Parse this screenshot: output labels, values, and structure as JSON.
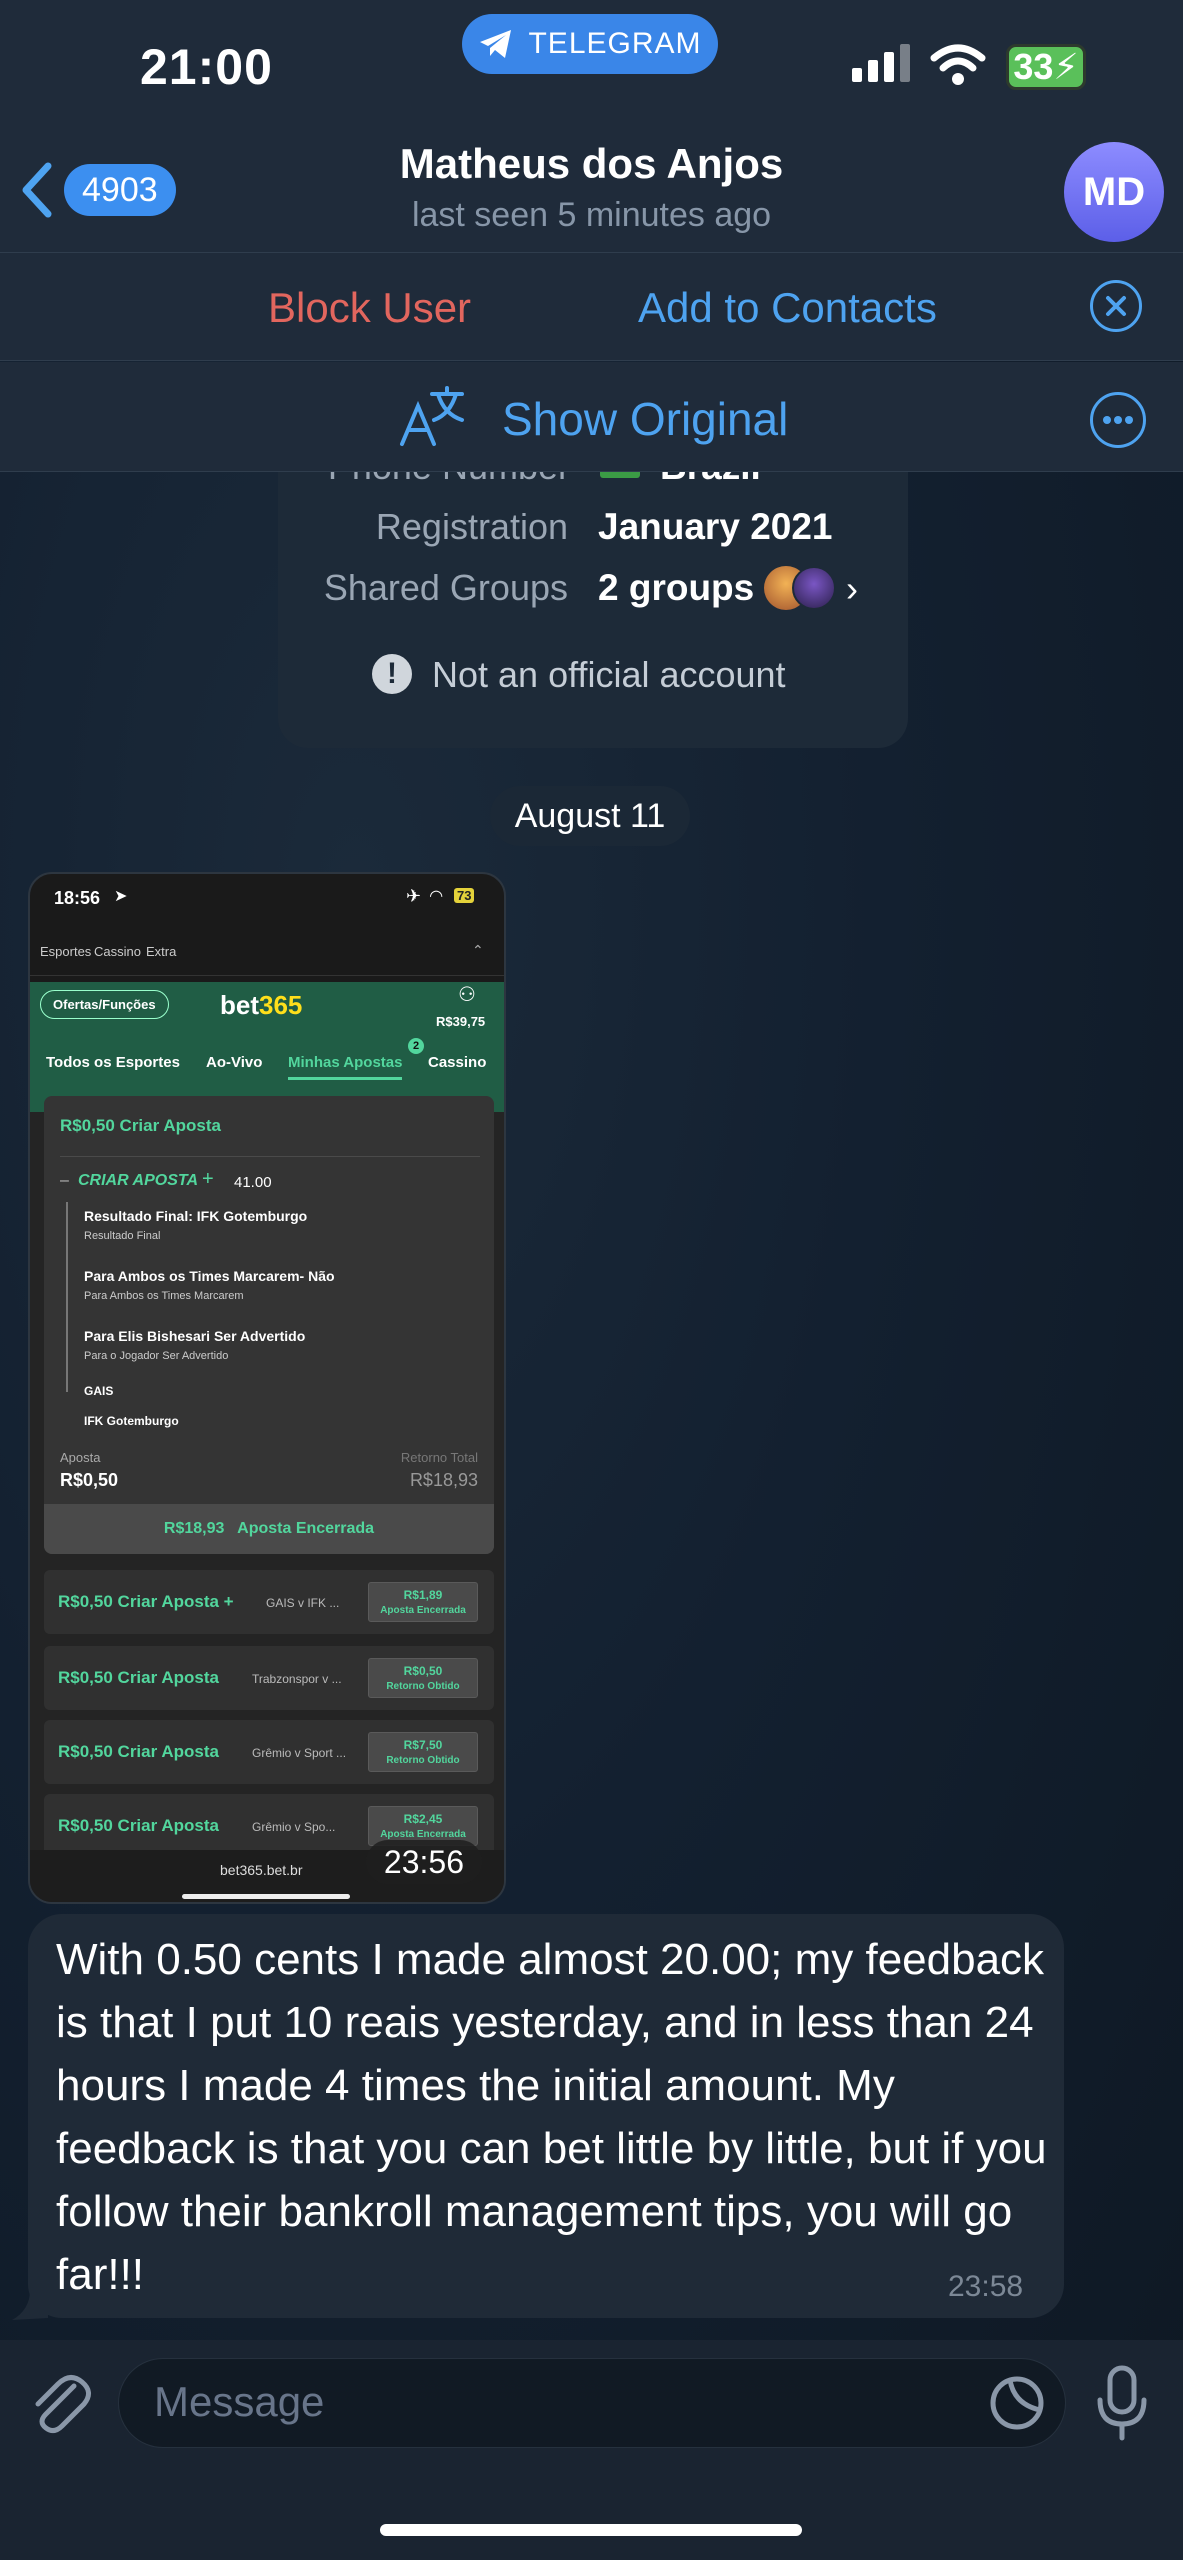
{
  "status_bar": {
    "time": "21:00",
    "battery": "33"
  },
  "telegram_pill": {
    "label": "TELEGRAM"
  },
  "header": {
    "back_count": "4903",
    "title": "Matheus dos Anjos",
    "subtitle": "last seen 5 minutes ago",
    "avatar_initials": "MD"
  },
  "actions": {
    "block": "Block User",
    "add_contacts": "Add to Contacts"
  },
  "translate": {
    "label": "Show Original"
  },
  "info_card": {
    "phone_label": "Phone Number",
    "phone_value": "Brazil",
    "registration_label": "Registration",
    "registration_value": "January 2021",
    "groups_label": "Shared Groups",
    "groups_value": "2 groups",
    "notice": "Not an official account"
  },
  "date_separator": "August 11",
  "screenshot": {
    "time": "18:56",
    "battery": "73",
    "nav": [
      "Esportes",
      "Cassino",
      "Extra"
    ],
    "offers": "Ofertas/Funções",
    "logo_a": "bet",
    "logo_b": "365",
    "balance": "R$39,75",
    "tabs": [
      "Todos os Esportes",
      "Ao-Vivo",
      "Minhas Apostas",
      "Cassino"
    ],
    "tab_badge": "2",
    "card_title": "R$0,50 Criar Aposta",
    "criar_label": "CRIAR APOSTA",
    "odds": "41.00",
    "selections": [
      {
        "title": "Resultado Final: IFK Gotemburgo",
        "sub": "Resultado Final"
      },
      {
        "title": "Para Ambos os Times Marcarem- Não",
        "sub": "Para Ambos os Times Marcarem"
      },
      {
        "title": "Para Elis Bishesari Ser Advertido",
        "sub": "Para o Jogador Ser Advertido"
      }
    ],
    "team1": "GAIS",
    "team2": "IFK Gotemburgo",
    "stake_label": "Aposta",
    "stake_value": "R$0,50",
    "return_label": "Retorno Total",
    "return_value": "R$18,93",
    "closed_bar": "R$18,93   Aposta Encerrada",
    "rows": [
      {
        "label": "R$0,50 Criar Aposta +",
        "meta": "GAIS v IFK ...",
        "amount": "R$1,89",
        "status": "Aposta Encerrada"
      },
      {
        "label": "R$0,50 Criar Aposta",
        "meta": "Trabzonspor v ...",
        "amount": "R$0,50",
        "status": "Retorno Obtido"
      },
      {
        "label": "R$0,50 Criar Aposta",
        "meta": "Grêmio v Sport ...",
        "amount": "R$7,50",
        "status": "Retorno Obtido"
      },
      {
        "label": "R$0,50 Criar Aposta",
        "meta": "Grêmio v Spo...",
        "amount": "R$2,45",
        "status": "Aposta Encerrada"
      }
    ],
    "url": "bet365.bet.br",
    "timestamp": "23:56"
  },
  "message": {
    "text": "With 0.50 cents I made almost 20.00; my feedback is that I put 10 reais yesterday, and in less than 24 hours I made 4 times the initial amount. My feedback is that you can bet little by little, but if you follow their bankroll management tips, you will go far!!!",
    "time": "23:58"
  },
  "composer": {
    "placeholder": "Message"
  },
  "colors": {
    "accent": "#4ea3f0",
    "danger": "#e2665e",
    "bet_green": "#52d69d",
    "header_bg": "#1f2b3a"
  }
}
